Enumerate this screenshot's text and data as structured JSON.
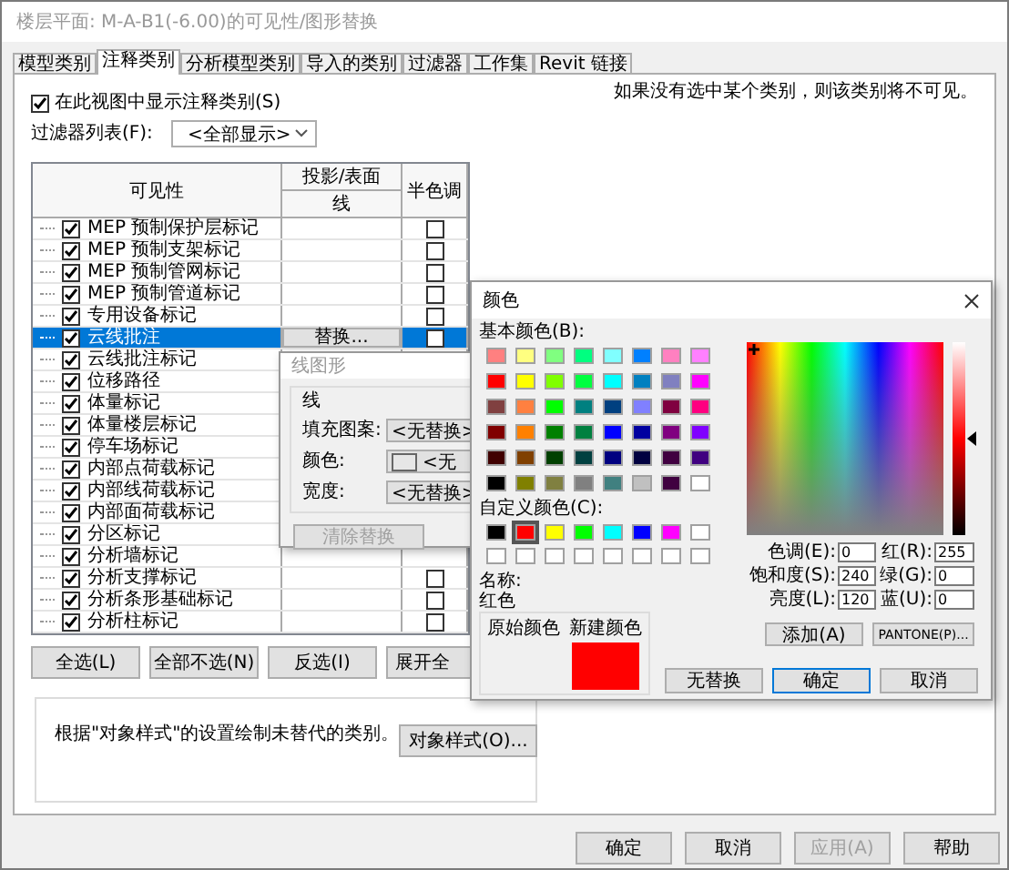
{
  "window": {
    "title": "楼层平面: M-A-B1(-6.00)的可见性/图形替换"
  },
  "tabs": [
    {
      "label": "模型类别",
      "selected": false
    },
    {
      "label": "注释类别",
      "selected": true
    },
    {
      "label": "分析模型类别",
      "selected": false
    },
    {
      "label": "导入的类别",
      "selected": false
    },
    {
      "label": "过滤器",
      "selected": false
    },
    {
      "label": "工作集",
      "selected": false
    },
    {
      "label": "Revit 链接",
      "selected": false
    }
  ],
  "show_annotation": {
    "label": "在此视图中显示注释类别(S)",
    "checked": true
  },
  "note": "如果没有选中某个类别，则该类别将不可见。",
  "filter_list": {
    "label": "过滤器列表(F):",
    "value": "<全部显示>"
  },
  "table": {
    "columns": [
      {
        "label": "可见性"
      },
      {
        "label": "投影/表面",
        "sub": "线"
      },
      {
        "label": "半色调"
      }
    ],
    "rows": [
      {
        "name": "MEP 预制保护层标记",
        "visible": true,
        "selected": false,
        "halftone": false
      },
      {
        "name": "MEP 预制支架标记",
        "visible": true,
        "selected": false,
        "halftone": false
      },
      {
        "name": "MEP 预制管网标记",
        "visible": true,
        "selected": false,
        "halftone": false
      },
      {
        "name": "MEP 预制管道标记",
        "visible": true,
        "selected": false,
        "halftone": false
      },
      {
        "name": "专用设备标记",
        "visible": true,
        "selected": false,
        "halftone": false
      },
      {
        "name": "云线批注",
        "visible": true,
        "selected": true,
        "halftone": false,
        "override_button": "替换..."
      },
      {
        "name": "云线批注标记",
        "visible": true,
        "selected": false
      },
      {
        "name": "位移路径",
        "visible": true,
        "selected": false
      },
      {
        "name": "体量标记",
        "visible": true,
        "selected": false
      },
      {
        "name": "体量楼层标记",
        "visible": true,
        "selected": false
      },
      {
        "name": "停车场标记",
        "visible": true,
        "selected": false
      },
      {
        "name": "内部点荷载标记",
        "visible": true,
        "selected": false
      },
      {
        "name": "内部线荷载标记",
        "visible": true,
        "selected": false
      },
      {
        "name": "内部面荷载标记",
        "visible": true,
        "selected": false
      },
      {
        "name": "分区标记",
        "visible": true,
        "selected": false
      },
      {
        "name": "分析墙标记",
        "visible": true,
        "selected": false
      },
      {
        "name": "分析支撑标记",
        "visible": true,
        "selected": false,
        "halftone": false
      },
      {
        "name": "分析条形基础标记",
        "visible": true,
        "selected": false,
        "halftone": false
      },
      {
        "name": "分析柱标记",
        "visible": true,
        "selected": false,
        "halftone": false
      }
    ]
  },
  "select_buttons": [
    "全选(L)",
    "全部不选(N)",
    "反选(I)",
    "展开全"
  ],
  "object_styles": {
    "text": "根据\"对象样式\"的设置绘制未替代的类别。",
    "button": "对象样式(O)..."
  },
  "footer_buttons": [
    {
      "label": "确定",
      "disabled": false
    },
    {
      "label": "取消",
      "disabled": false
    },
    {
      "label": "应用(A)",
      "disabled": true
    },
    {
      "label": "帮助",
      "disabled": false
    }
  ],
  "line_graphics": {
    "title": "线图形",
    "group": "线",
    "fields": [
      {
        "label": "填充图案:",
        "kind": "select",
        "value": "<无替换>"
      },
      {
        "label": "颜色:",
        "kind": "color",
        "value": "<无"
      },
      {
        "label": "宽度:",
        "kind": "select",
        "value": "<无替换>"
      }
    ],
    "clear_button": {
      "label": "清除替换",
      "disabled": true
    }
  },
  "color_dialog": {
    "title": "颜色",
    "basic_label": "基本颜色(B):",
    "basic_colors": [
      {
        "color": "#ff8080",
        "selected": false
      },
      {
        "color": "#ffff80",
        "selected": false
      },
      {
        "color": "#80ff80",
        "selected": false
      },
      {
        "color": "#00ff80",
        "selected": false
      },
      {
        "color": "#80ffff",
        "selected": false
      },
      {
        "color": "#0080ff",
        "selected": false
      },
      {
        "color": "#ff80c0",
        "selected": false
      },
      {
        "color": "#ff80ff",
        "selected": false
      },
      {
        "color": "#ff0000",
        "selected": false
      },
      {
        "color": "#ffff00",
        "selected": false
      },
      {
        "color": "#80ff00",
        "selected": false
      },
      {
        "color": "#00ff40",
        "selected": false
      },
      {
        "color": "#00ffff",
        "selected": false
      },
      {
        "color": "#0080c0",
        "selected": false
      },
      {
        "color": "#8080c0",
        "selected": false
      },
      {
        "color": "#ff00ff",
        "selected": false
      },
      {
        "color": "#804040",
        "selected": false
      },
      {
        "color": "#ff8040",
        "selected": false
      },
      {
        "color": "#00ff00",
        "selected": false
      },
      {
        "color": "#008080",
        "selected": false
      },
      {
        "color": "#004080",
        "selected": false
      },
      {
        "color": "#8080ff",
        "selected": false
      },
      {
        "color": "#800040",
        "selected": false
      },
      {
        "color": "#ff0080",
        "selected": false
      },
      {
        "color": "#800000",
        "selected": false
      },
      {
        "color": "#ff8000",
        "selected": false
      },
      {
        "color": "#008000",
        "selected": false
      },
      {
        "color": "#008040",
        "selected": false
      },
      {
        "color": "#0000ff",
        "selected": false
      },
      {
        "color": "#0000a0",
        "selected": false
      },
      {
        "color": "#800080",
        "selected": false
      },
      {
        "color": "#8000ff",
        "selected": false
      },
      {
        "color": "#400000",
        "selected": false
      },
      {
        "color": "#804000",
        "selected": false
      },
      {
        "color": "#004000",
        "selected": false
      },
      {
        "color": "#004040",
        "selected": false
      },
      {
        "color": "#000080",
        "selected": false
      },
      {
        "color": "#000040",
        "selected": false
      },
      {
        "color": "#400040",
        "selected": false
      },
      {
        "color": "#400080",
        "selected": false
      },
      {
        "color": "#000000",
        "selected": false
      },
      {
        "color": "#808000",
        "selected": false
      },
      {
        "color": "#808040",
        "selected": false
      },
      {
        "color": "#808080",
        "selected": false
      },
      {
        "color": "#408080",
        "selected": false
      },
      {
        "color": "#c0c0c0",
        "selected": false
      },
      {
        "color": "#400040",
        "selected": false
      },
      {
        "color": "#ffffff",
        "selected": false
      }
    ],
    "custom_label": "自定义颜色(C):",
    "custom_colors": [
      {
        "color": "#000000",
        "selected": false
      },
      {
        "color": "#ff0000",
        "selected": true
      },
      {
        "color": "#ffff00",
        "selected": false
      },
      {
        "color": "#00ff00",
        "selected": false
      },
      {
        "color": "#00ffff",
        "selected": false
      },
      {
        "color": "#0000ff",
        "selected": false
      },
      {
        "color": "#ff00ff",
        "selected": false
      },
      {
        "color": "#ffffff",
        "selected": false
      },
      {
        "color": "#ffffff",
        "selected": false
      },
      {
        "color": "#ffffff",
        "selected": false
      },
      {
        "color": "#ffffff",
        "selected": false
      },
      {
        "color": "#ffffff",
        "selected": false
      },
      {
        "color": "#ffffff",
        "selected": false
      },
      {
        "color": "#ffffff",
        "selected": false
      },
      {
        "color": "#ffffff",
        "selected": false
      },
      {
        "color": "#ffffff",
        "selected": false
      }
    ],
    "luminance": {
      "level": 0.5
    },
    "name_label": "名称:",
    "name": "红色",
    "original_label": "原始颜色",
    "new_label": "新建颜色",
    "fields": [
      {
        "label": "色调(E):",
        "value": "0"
      },
      {
        "label": "红(R):",
        "value": "255"
      },
      {
        "label": "饱和度(S):",
        "value": "240"
      },
      {
        "label": "绿(G):",
        "value": "0"
      },
      {
        "label": "亮度(L):",
        "value": "120"
      },
      {
        "label": "蓝(U):",
        "value": "0"
      }
    ],
    "add_button": "添加(A)",
    "pantone_button": "PANTONE(P)...",
    "buttons": [
      {
        "label": "无替换",
        "default": false
      },
      {
        "label": "确定",
        "default": true
      },
      {
        "label": "取消",
        "default": false
      }
    ]
  }
}
